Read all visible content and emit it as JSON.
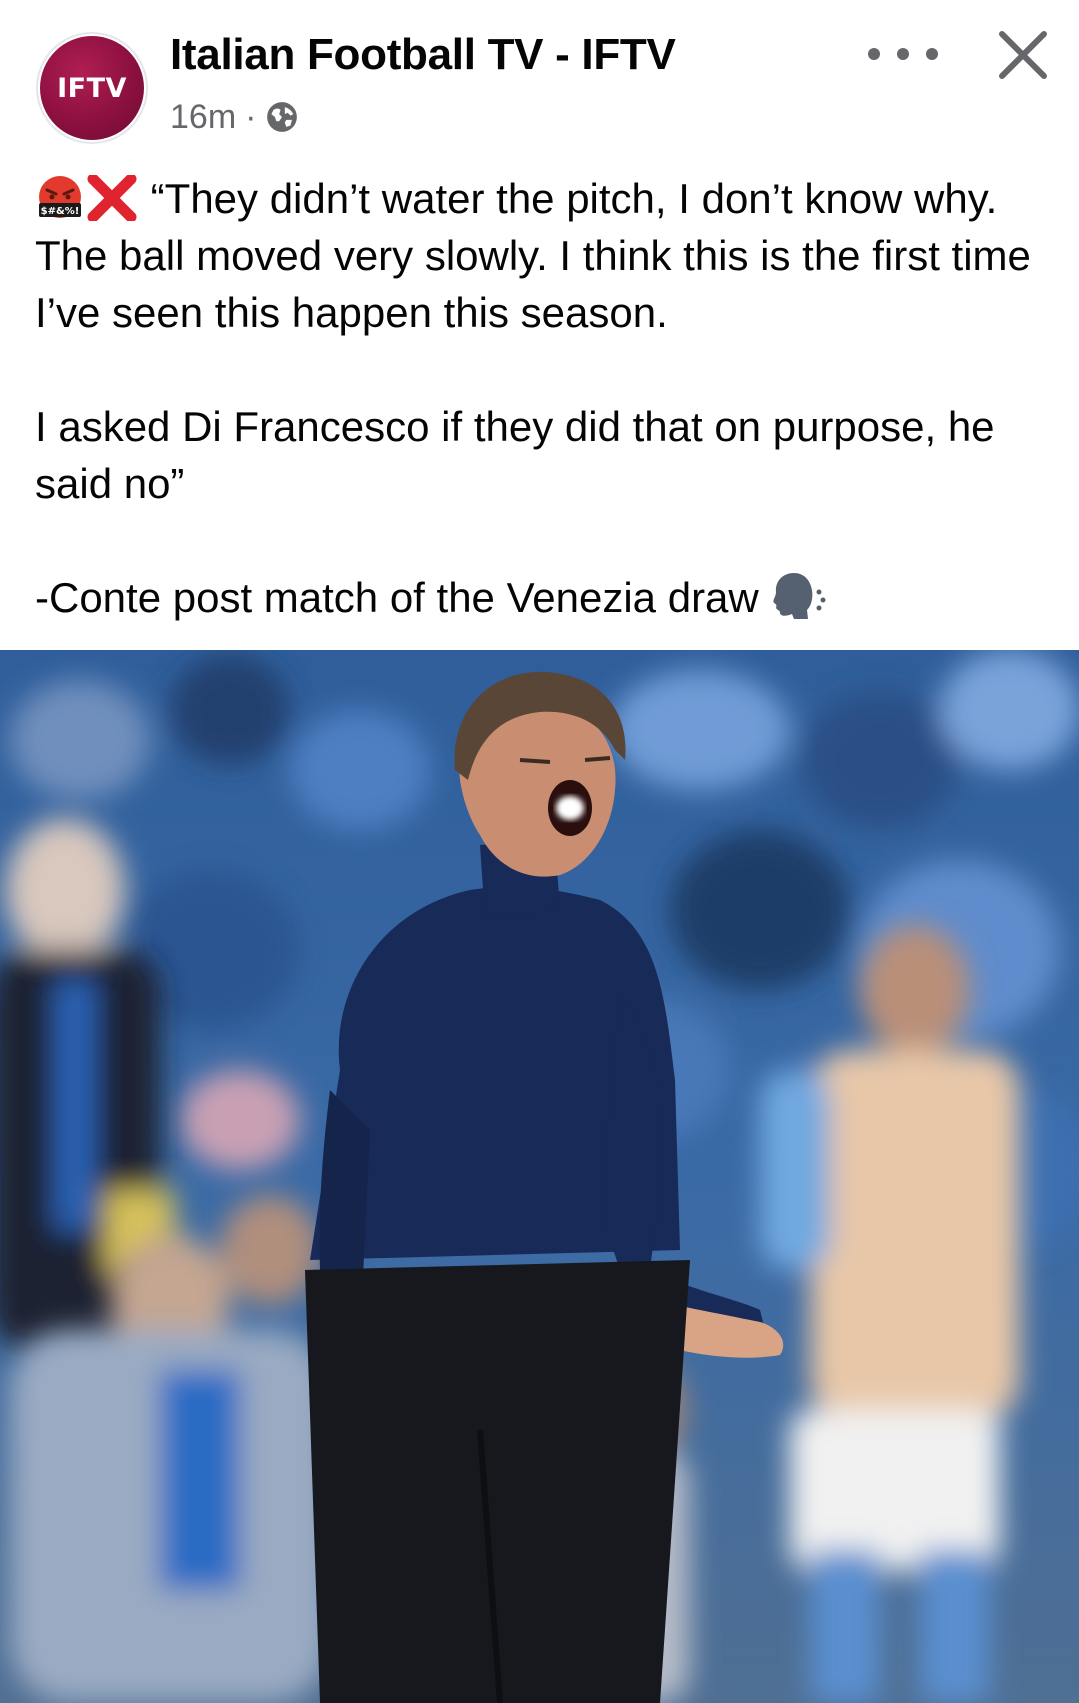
{
  "post": {
    "page_name": "Italian Football TV - IFTV",
    "avatar_text": "IFTV",
    "timestamp": "16m",
    "separator": "·",
    "privacy_icon": "globe-icon",
    "menu_icon": "more-options-icon",
    "close_icon": "close-icon",
    "text": {
      "line1": "“They didn’t water the pitch, I don’t know why. The ball moved very slowly. I think this is the first time I’ve seen this happen this season.",
      "line2": "I asked Di Francesco if they did that on purpose, he said no”",
      "line3": "-Conte post match of the Venezia draw",
      "emoji_cursing_text": "$#&%!"
    },
    "emojis": [
      "face-with-symbols-on-mouth-emoji",
      "cross-mark-emoji",
      "speaking-head-emoji"
    ],
    "image": {
      "icon": "post-photo"
    }
  },
  "colors": {
    "avatar": "#8c1040",
    "secondary_text": "#65676b",
    "cross_mark": "#e0242f"
  }
}
